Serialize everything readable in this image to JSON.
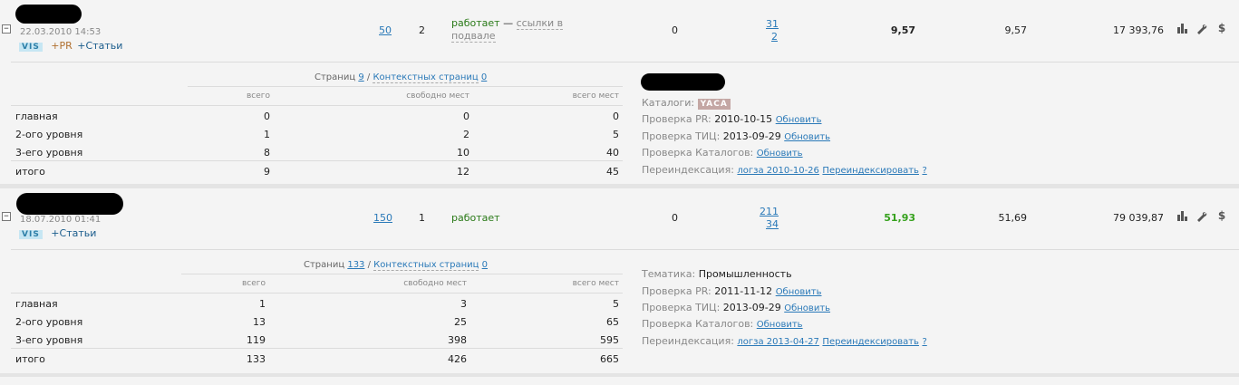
{
  "sites": [
    {
      "date": "22.03.2010 14:53",
      "tags": [
        "VIS",
        "+PR",
        "+Статьи"
      ],
      "col_links": "50",
      "col_level": "2",
      "status": "работает",
      "status_dash": "—",
      "status_note": "ссылки в подвале",
      "col_zero": "0",
      "col_pages_top": "31",
      "col_pages_bottom": "2",
      "price_main": "9,57",
      "price_second": "9,57",
      "total": "17 393,76",
      "pages_caption": {
        "pages_label": "Страниц",
        "pages_value": "9",
        "slash": "/",
        "ctx_label": "Контекстных страниц",
        "ctx_value": "0"
      },
      "table_headers": [
        "всего",
        "свободно мест",
        "всего мест"
      ],
      "table_rows": [
        {
          "label": "главная",
          "total": "0",
          "free": "0",
          "all": "0"
        },
        {
          "label": "2-ого уровня",
          "total": "1",
          "free": "2",
          "all": "5"
        },
        {
          "label": "3-его уровня",
          "total": "8",
          "free": "10",
          "all": "40"
        },
        {
          "label": "итого",
          "total": "9",
          "free": "12",
          "all": "45"
        }
      ],
      "info": {
        "catalogs_label": "Каталоги:",
        "catalogs_badge": "YACA",
        "pr_label": "Проверка PR:",
        "pr_date": "2010-10-15",
        "pr_link": "Обновить",
        "tic_label": "Проверка ТИЦ:",
        "tic_date": "2013-09-29",
        "tic_link": "Обновить",
        "cat_label": "Проверка Каталогов:",
        "cat_link": "Обновить",
        "reindex_label": "Переиндексация:",
        "reindex_link": "логза 2010-10-26",
        "reindex_action": "Переиндексировать",
        "reindex_help": "?"
      }
    },
    {
      "date": "18.07.2010 01:41",
      "tags": [
        "VIS",
        "+Статьи"
      ],
      "col_links": "150",
      "col_level": "1",
      "status": "работает",
      "col_zero": "0",
      "col_pages_top": "211",
      "col_pages_bottom": "34",
      "price_main": "51,93",
      "price_second": "51,69",
      "total": "79 039,87",
      "pages_caption": {
        "pages_label": "Страниц",
        "pages_value": "133",
        "slash": "/",
        "ctx_label": "Контекстных страниц",
        "ctx_value": "0"
      },
      "table_headers": [
        "всего",
        "свободно мест",
        "всего мест"
      ],
      "table_rows": [
        {
          "label": "главная",
          "total": "1",
          "free": "3",
          "all": "5"
        },
        {
          "label": "2-ого уровня",
          "total": "13",
          "free": "25",
          "all": "65"
        },
        {
          "label": "3-его уровня",
          "total": "119",
          "free": "398",
          "all": "595"
        },
        {
          "label": "итого",
          "total": "133",
          "free": "426",
          "all": "665"
        }
      ],
      "info": {
        "theme_label": "Тематика:",
        "theme_value": "Промышленность",
        "pr_label": "Проверка PR:",
        "pr_date": "2011-11-12",
        "pr_link": "Обновить",
        "tic_label": "Проверка ТИЦ:",
        "tic_date": "2013-09-29",
        "tic_link": "Обновить",
        "cat_label": "Проверка Каталогов:",
        "cat_link": "Обновить",
        "reindex_label": "Переиндексация:",
        "reindex_link": "логза 2013-04-27",
        "reindex_action": "Переиндексировать",
        "reindex_help": "?"
      }
    }
  ],
  "toggle_symbol": "⊟",
  "icons": [
    "stats-icon",
    "wrench-icon",
    "dollar-icon"
  ],
  "dollar_glyph": "$"
}
